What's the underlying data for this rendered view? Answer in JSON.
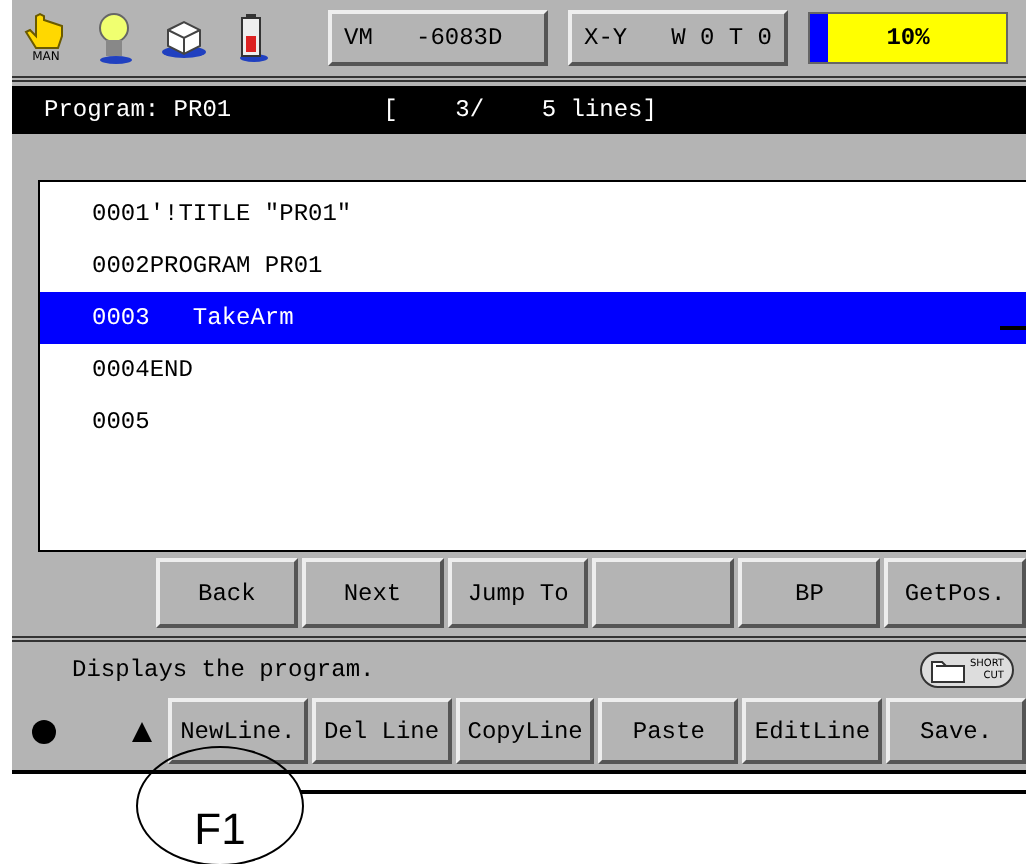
{
  "status_bar": {
    "mode_label": "MAN",
    "position_button": "VM   -6083D",
    "coord_button": {
      "system": "X-Y",
      "tool": "W 0 T 0"
    },
    "speed": {
      "level": 0.1,
      "reading": "10%"
    }
  },
  "title_bar": {
    "title": "Program: PR01",
    "line_info": "[    3/    5 lines]"
  },
  "listing": {
    "rows": [
      {
        "number": "0001",
        "code": "'!TITLE \"PR01\"",
        "selected": false
      },
      {
        "number": "0002",
        "code": "PROGRAM PR01",
        "selected": false
      },
      {
        "number": "0003",
        "code": "   TakeArm",
        "selected": true
      },
      {
        "number": "0004",
        "code": "END",
        "selected": false
      },
      {
        "number": "0005",
        "selected": false
      }
    ]
  },
  "nav_buttons": [
    {
      "kind": "key",
      "label": "Back"
    },
    {
      "kind": "key",
      "label": "Next"
    },
    {
      "kind": "key",
      "label": "Jump To"
    },
    {
      "kind": "blank"
    },
    {
      "kind": "key",
      "label": "BP"
    },
    {
      "kind": "key",
      "label": "GetPos."
    }
  ],
  "message": "Displays the program.",
  "shortcut": {
    "line1": "SHORT",
    "line2": "CUT"
  },
  "function_keys": [
    {
      "label": "NewLine."
    },
    {
      "label": "Del Line"
    },
    {
      "label": "CopyLine"
    },
    {
      "label": "Paste"
    },
    {
      "label": "EditLine"
    },
    {
      "label": "Save."
    }
  ],
  "callout": {
    "label": "F1"
  }
}
